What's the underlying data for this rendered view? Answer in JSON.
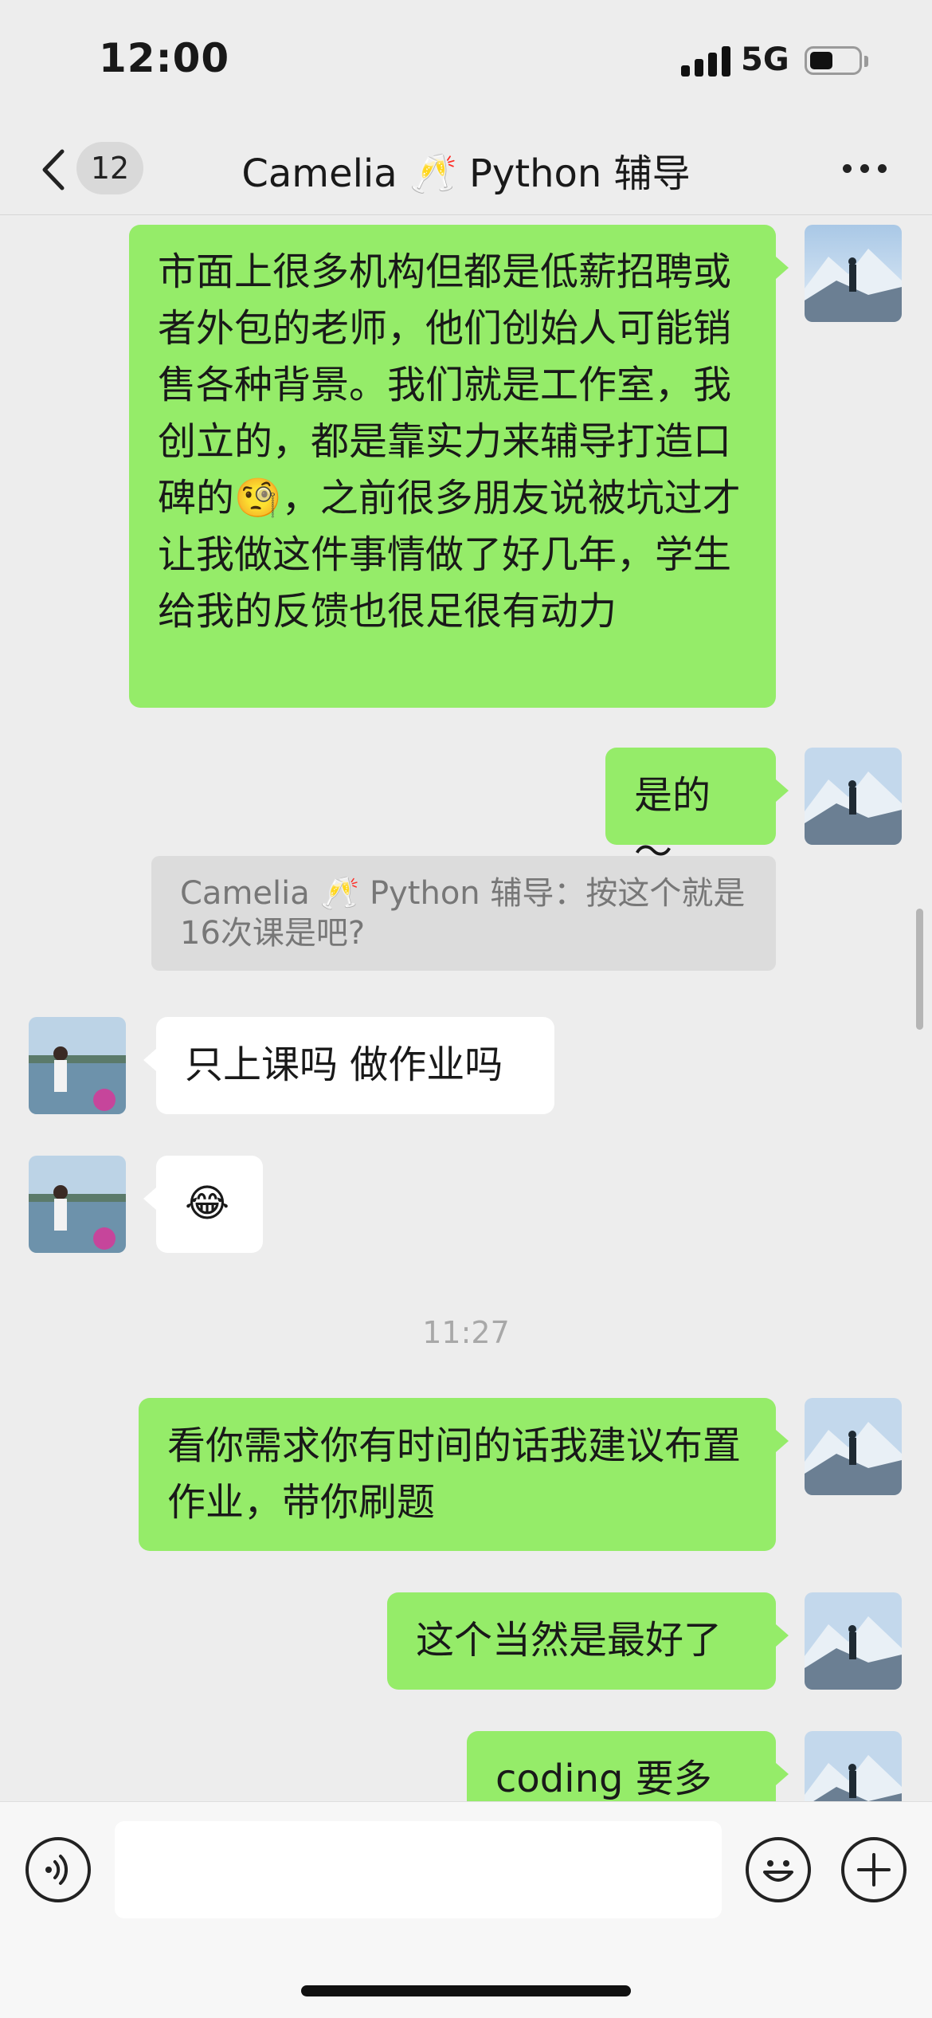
{
  "status_bar": {
    "time": "12:00",
    "network": "5G"
  },
  "nav": {
    "unread_count": "12",
    "title": "Camelia 🥂 Python 辅导"
  },
  "messages": [
    {
      "text": "市面上很多机构但都是低薪招聘或者外包的老师，他们创始人可能销售各种背景。我们就是工作室，我创立的，都是靠实力来辅导打造口碑的🧐，之前很多朋友说被坑过才让我做这件事情做了好几年，学生给我的反馈也很足很有动力"
    },
    {
      "text": "是的～"
    },
    {
      "text": "Camelia 🥂 Python 辅导：按这个就是16次课是吧?"
    },
    {
      "text": "只上课吗 做作业吗"
    },
    {
      "text": "😂"
    },
    {
      "text": "11:27"
    },
    {
      "text": "看你需求你有时间的话我建议布置作业，带你刷题"
    },
    {
      "text": "这个当然是最好了"
    },
    {
      "text": "coding 要多些"
    }
  ],
  "colors": {
    "my_bubble": "#95ec69",
    "their_bubble": "#ffffff",
    "background": "#ededed"
  },
  "icons": [
    "back-chevron-icon",
    "more-dots-icon",
    "voice-icon",
    "emoji-icon",
    "plus-icon"
  ]
}
